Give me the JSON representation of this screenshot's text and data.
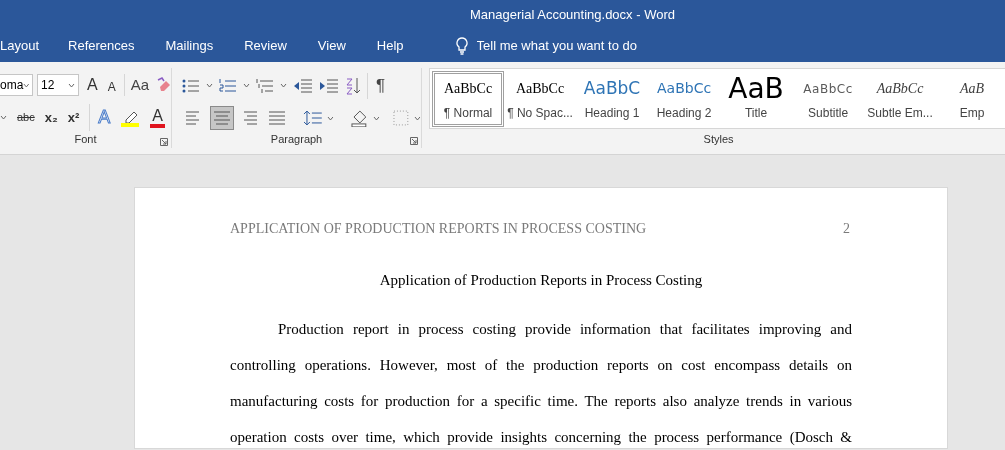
{
  "window": {
    "title": "Managerial Accounting.docx  -  Word"
  },
  "menu_tabs": [
    {
      "label": "Layout",
      "selected": false
    },
    {
      "label": "References",
      "selected": false
    },
    {
      "label": "Mailings",
      "selected": false
    },
    {
      "label": "Review",
      "selected": false
    },
    {
      "label": "View",
      "selected": false
    },
    {
      "label": "Help",
      "selected": false
    }
  ],
  "tell_me": {
    "placeholder": "Tell me what you want to do"
  },
  "ribbon": {
    "font": {
      "label": "Font",
      "font_name": "oma",
      "font_size": "12",
      "grow": "A",
      "shrink": "A",
      "change_case": "Aa",
      "strikethrough": "abc",
      "subscript": "x₂",
      "superscript": "x²",
      "text_effects": "A",
      "font_color": "A"
    },
    "paragraph": {
      "label": "Paragraph",
      "show_marks": "¶",
      "alignments": [
        {
          "kind": "left",
          "selected": false
        },
        {
          "kind": "center",
          "selected": true
        },
        {
          "kind": "right",
          "selected": false
        },
        {
          "kind": "justify",
          "selected": false
        }
      ]
    },
    "styles": {
      "label": "Styles",
      "items": [
        {
          "kind": "normal",
          "preview": "AaBbCc",
          "name": "¶ Normal",
          "selected": true
        },
        {
          "kind": "normal",
          "preview": "AaBbCc",
          "name": "¶ No Spac...",
          "selected": false
        },
        {
          "kind": "heading1",
          "preview": "AaBbC",
          "name": "Heading 1",
          "selected": false
        },
        {
          "kind": "heading2",
          "preview": "AaBbCc",
          "name": "Heading 2",
          "selected": false
        },
        {
          "kind": "title",
          "preview": "AaB",
          "name": "Title",
          "selected": false
        },
        {
          "kind": "subtitle",
          "preview": "AaBbCc",
          "name": "Subtitle",
          "selected": false
        },
        {
          "kind": "emphasis",
          "preview": "AaBbCc",
          "name": "Subtle Em...",
          "selected": false
        },
        {
          "kind": "emphasis",
          "preview": "AaB",
          "name": "Emp",
          "selected": false
        }
      ]
    }
  },
  "document": {
    "header": "APPLICATION OF PRODUCTION REPORTS IN PROCESS COSTING",
    "page_number": "2",
    "title": "Application of Production Reports in Process Costing",
    "paragraph_lines": [
      "Production report in process costing provide information that facilitates improving and",
      "controlling operations. However, most of the production reports on cost encompass details on",
      "manufacturing costs for production for a specific time. The reports also analyze trends in various",
      "operation costs over time, which provide insights concerning the process performance (Dosch &"
    ]
  }
}
